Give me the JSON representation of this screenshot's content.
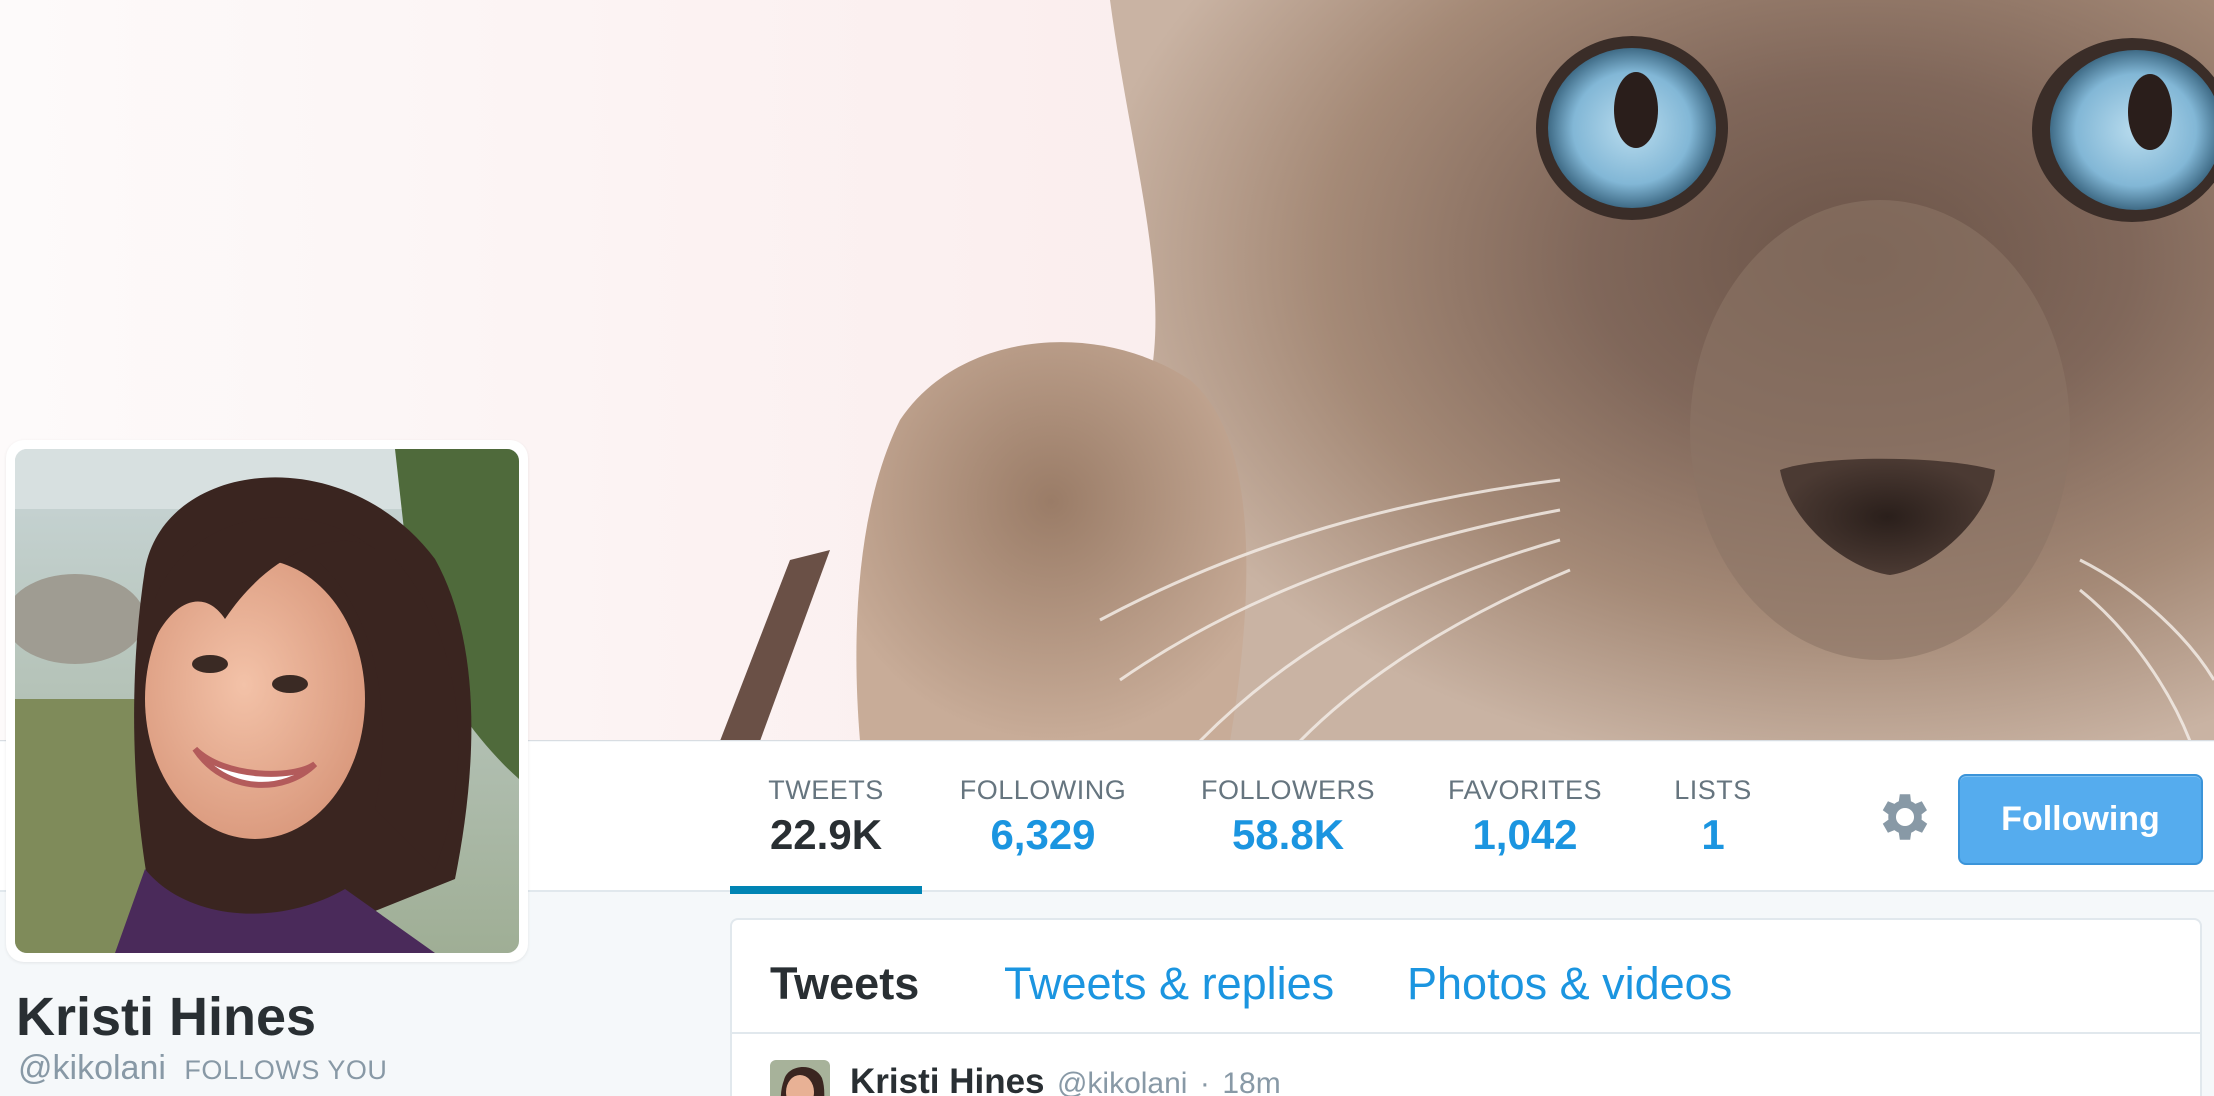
{
  "header": {
    "banner_alt": "cat-header-photo"
  },
  "stats": {
    "tweets": {
      "label": "TWEETS",
      "value": "22.9K"
    },
    "following": {
      "label": "FOLLOWING",
      "value": "6,329"
    },
    "followers": {
      "label": "FOLLOWERS",
      "value": "58.8K"
    },
    "favorites": {
      "label": "FAVORITES",
      "value": "1,042"
    },
    "lists": {
      "label": "LISTS",
      "value": "1"
    },
    "active": "tweets"
  },
  "actions": {
    "settings_icon": "gear-icon",
    "follow_button_label": "Following"
  },
  "profile": {
    "name": "Kristi Hines",
    "handle": "@kikolani",
    "follows_you": "FOLLOWS YOU"
  },
  "timeline": {
    "tabs": [
      {
        "label": "Tweets",
        "active": true
      },
      {
        "label": "Tweets & replies",
        "active": false
      },
      {
        "label": "Photos & videos",
        "active": false
      }
    ],
    "first_tweet": {
      "author": "Kristi Hines",
      "handle": "@kikolani",
      "separator": "·",
      "time": "18m"
    }
  },
  "colors": {
    "accent": "#1b95e0",
    "button": "#55acee",
    "active_underline": "#0084b4",
    "text_dark": "#292f33",
    "text_muted": "#66757f",
    "background": "#f5f8fa"
  }
}
